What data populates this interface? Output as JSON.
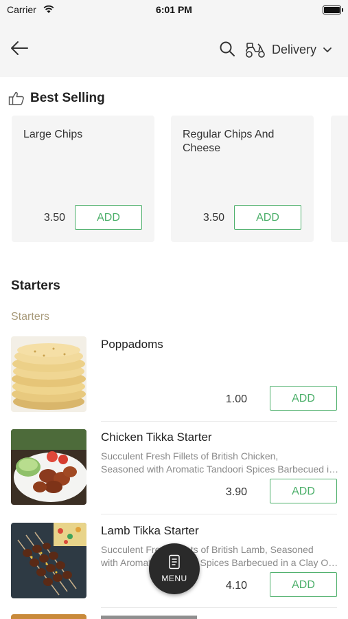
{
  "status_bar": {
    "carrier": "Carrier",
    "time": "6:01 PM"
  },
  "header": {
    "delivery_label": "Delivery"
  },
  "best_selling": {
    "title": "Best Selling",
    "items": [
      {
        "name": "Large Chips",
        "price": "3.50",
        "add_label": "ADD"
      },
      {
        "name": "Regular Chips And Cheese",
        "price": "3.50",
        "add_label": "ADD"
      }
    ]
  },
  "starters": {
    "title": "Starters",
    "subtitle": "Starters",
    "items": [
      {
        "name": "Poppadoms",
        "desc1": "",
        "desc2": "",
        "price": "1.00",
        "add_label": "ADD"
      },
      {
        "name": "Chicken Tikka Starter",
        "desc1": "Succulent Fresh Fillets of British Chicken,",
        "desc2": "Seasoned with Aromatic Tandoori Spices Barbecued in a Clay Oven",
        "price": "3.90",
        "add_label": "ADD"
      },
      {
        "name": "Lamb Tikka Starter",
        "desc1": "Succulent Fresh Fillets of British Lamb, Seasoned",
        "desc2": "with Aromatic Tandoori Spices Barbecued in a Clay Oven",
        "price": "4.10",
        "add_label": "ADD"
      }
    ]
  },
  "fab": {
    "label": "MENU"
  },
  "icons": [
    "wifi-icon",
    "battery-icon",
    "back-arrow-icon",
    "search-icon",
    "scooter-icon",
    "chevron-down-icon",
    "thumbs-up-icon",
    "menu-card-icon"
  ],
  "colors": {
    "accent_green": "#4caf6a",
    "subsection_tan": "#a89a7a",
    "header_bg": "#f5f5f5",
    "fab_bg": "#2a2a2a"
  }
}
